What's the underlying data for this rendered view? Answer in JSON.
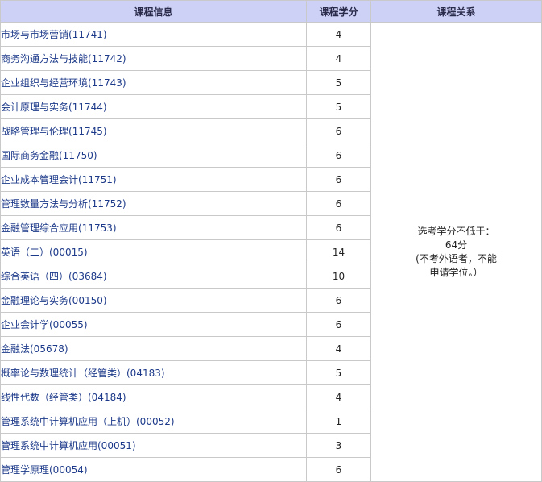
{
  "header": {
    "course_info": "课程信息",
    "credits": "课程学分",
    "relation": "课程关系"
  },
  "courses": [
    {
      "name": "市场与市场营销(11741)",
      "credit": "4"
    },
    {
      "name": "商务沟通方法与技能(11742)",
      "credit": "4"
    },
    {
      "name": "企业组织与经营环境(11743)",
      "credit": "5"
    },
    {
      "name": "会计原理与实务(11744)",
      "credit": "5"
    },
    {
      "name": "战略管理与伦理(11745)",
      "credit": "6"
    },
    {
      "name": "国际商务金融(11750)",
      "credit": "6"
    },
    {
      "name": "企业成本管理会计(11751)",
      "credit": "6"
    },
    {
      "name": "管理数量方法与分析(11752)",
      "credit": "6"
    },
    {
      "name": "金融管理综合应用(11753)",
      "credit": "6"
    },
    {
      "name": "英语（二）(00015)",
      "credit": "14"
    },
    {
      "name": "综合英语（四）(03684)",
      "credit": "10"
    },
    {
      "name": "金融理论与实务(00150)",
      "credit": "6"
    },
    {
      "name": "企业会计学(00055)",
      "credit": "6"
    },
    {
      "name": "金融法(05678)",
      "credit": "4"
    },
    {
      "name": "概率论与数理统计（经管类）(04183)",
      "credit": "5"
    },
    {
      "name": "线性代数（经管类）(04184)",
      "credit": "4"
    },
    {
      "name": "管理系统中计算机应用（上机）(00052)",
      "credit": "1"
    },
    {
      "name": "管理系统中计算机应用(00051)",
      "credit": "3"
    },
    {
      "name": "管理学原理(00054)",
      "credit": "6"
    }
  ],
  "relation": {
    "line1": "选考学分不低于：",
    "line2": "64分",
    "line3": "(不考外语者，不能",
    "line4": "申请学位。）"
  }
}
